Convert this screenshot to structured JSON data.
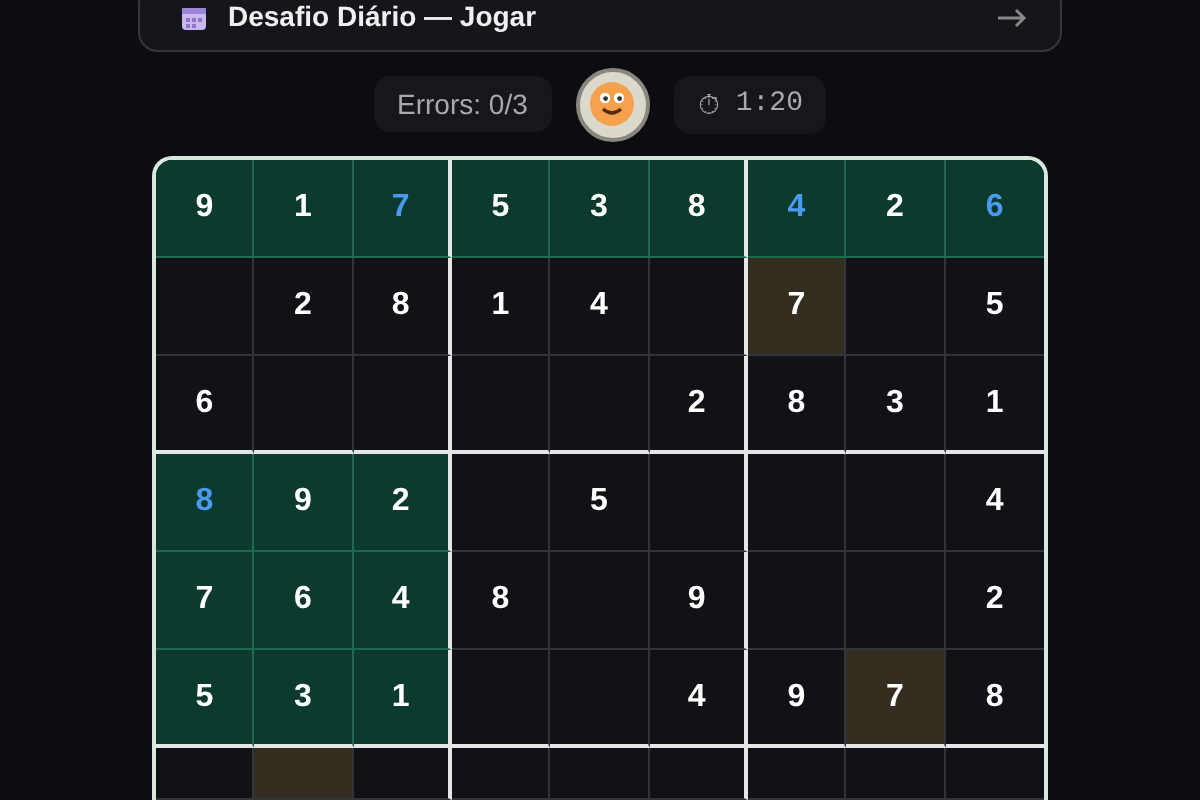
{
  "banner": {
    "title": "Desafio Diário — Jogar"
  },
  "stats": {
    "errors": "Errors: 0/3",
    "timer_icon": "⏱",
    "timer": "1:20"
  },
  "grid": {
    "rows": [
      [
        {
          "value": "9",
          "user": false,
          "completed": true,
          "highlighted": false
        },
        {
          "value": "1",
          "user": false,
          "completed": true,
          "highlighted": false
        },
        {
          "value": "7",
          "user": true,
          "completed": true,
          "highlighted": false
        },
        {
          "value": "5",
          "user": false,
          "completed": true,
          "highlighted": false
        },
        {
          "value": "3",
          "user": false,
          "completed": true,
          "highlighted": false
        },
        {
          "value": "8",
          "user": false,
          "completed": true,
          "highlighted": false
        },
        {
          "value": "4",
          "user": true,
          "completed": true,
          "highlighted": false
        },
        {
          "value": "2",
          "user": false,
          "completed": true,
          "highlighted": false
        },
        {
          "value": "6",
          "user": true,
          "completed": true,
          "highlighted": false
        }
      ],
      [
        {
          "completed": false,
          "highlighted": false
        },
        {
          "value": "2",
          "user": false,
          "completed": false,
          "highlighted": false
        },
        {
          "value": "8",
          "user": false,
          "completed": false,
          "highlighted": false
        },
        {
          "value": "1",
          "user": false,
          "completed": false,
          "highlighted": false
        },
        {
          "value": "4",
          "user": false,
          "completed": false,
          "highlighted": false
        },
        {
          "completed": false,
          "highlighted": false
        },
        {
          "value": "7",
          "user": false,
          "completed": false,
          "highlighted": true
        },
        {
          "completed": false,
          "highlighted": false
        },
        {
          "value": "5",
          "user": false,
          "completed": false,
          "highlighted": false
        }
      ],
      [
        {
          "value": "6",
          "user": false,
          "completed": false,
          "highlighted": false
        },
        {
          "completed": false,
          "highlighted": false
        },
        {
          "completed": false,
          "highlighted": false
        },
        {
          "completed": false,
          "highlighted": false
        },
        {
          "completed": false,
          "highlighted": false
        },
        {
          "value": "2",
          "user": false,
          "completed": false,
          "highlighted": false
        },
        {
          "value": "8",
          "user": false,
          "completed": false,
          "highlighted": false
        },
        {
          "value": "3",
          "user": false,
          "completed": false,
          "highlighted": false
        },
        {
          "value": "1",
          "user": false,
          "completed": false,
          "highlighted": false
        }
      ],
      [
        {
          "value": "8",
          "user": true,
          "completed": true,
          "highlighted": false
        },
        {
          "value": "9",
          "user": false,
          "completed": true,
          "highlighted": false
        },
        {
          "value": "2",
          "user": false,
          "completed": true,
          "highlighted": false
        },
        {
          "completed": false,
          "highlighted": false
        },
        {
          "value": "5",
          "user": false,
          "completed": false,
          "highlighted": false
        },
        {
          "completed": false,
          "highlighted": false
        },
        {
          "completed": false,
          "highlighted": false
        },
        {
          "completed": false,
          "highlighted": false
        },
        {
          "value": "4",
          "user": false,
          "completed": false,
          "highlighted": false
        }
      ],
      [
        {
          "value": "7",
          "user": false,
          "completed": true,
          "highlighted": false
        },
        {
          "value": "6",
          "user": false,
          "completed": true,
          "highlighted": false
        },
        {
          "value": "4",
          "user": false,
          "completed": true,
          "highlighted": false
        },
        {
          "value": "8",
          "user": false,
          "completed": false,
          "highlighted": false
        },
        {
          "completed": false,
          "highlighted": false
        },
        {
          "value": "9",
          "user": false,
          "completed": false,
          "highlighted": false
        },
        {
          "completed": false,
          "highlighted": false
        },
        {
          "completed": false,
          "highlighted": false
        },
        {
          "value": "2",
          "user": false,
          "completed": false,
          "highlighted": false
        }
      ],
      [
        {
          "value": "5",
          "user": false,
          "completed": true,
          "highlighted": false
        },
        {
          "value": "3",
          "user": false,
          "completed": true,
          "highlighted": false
        },
        {
          "value": "1",
          "user": false,
          "completed": true,
          "highlighted": false
        },
        {
          "completed": false,
          "highlighted": false
        },
        {
          "completed": false,
          "highlighted": false
        },
        {
          "value": "4",
          "user": false,
          "completed": false,
          "highlighted": false
        },
        {
          "value": "9",
          "user": false,
          "completed": false,
          "highlighted": false
        },
        {
          "value": "7",
          "user": false,
          "completed": false,
          "highlighted": true
        },
        {
          "value": "8",
          "user": false,
          "completed": false,
          "highlighted": false
        }
      ],
      [
        {
          "completed": false,
          "highlighted": false
        },
        {
          "completed": false,
          "highlighted": true
        },
        {
          "completed": false,
          "highlighted": false
        },
        {
          "completed": false,
          "highlighted": false
        },
        {
          "completed": false,
          "highlighted": false
        },
        {
          "completed": false,
          "highlighted": false
        },
        {
          "completed": false,
          "highlighted": false
        },
        {
          "completed": false,
          "highlighted": false
        },
        {
          "completed": false,
          "highlighted": false
        }
      ]
    ]
  }
}
